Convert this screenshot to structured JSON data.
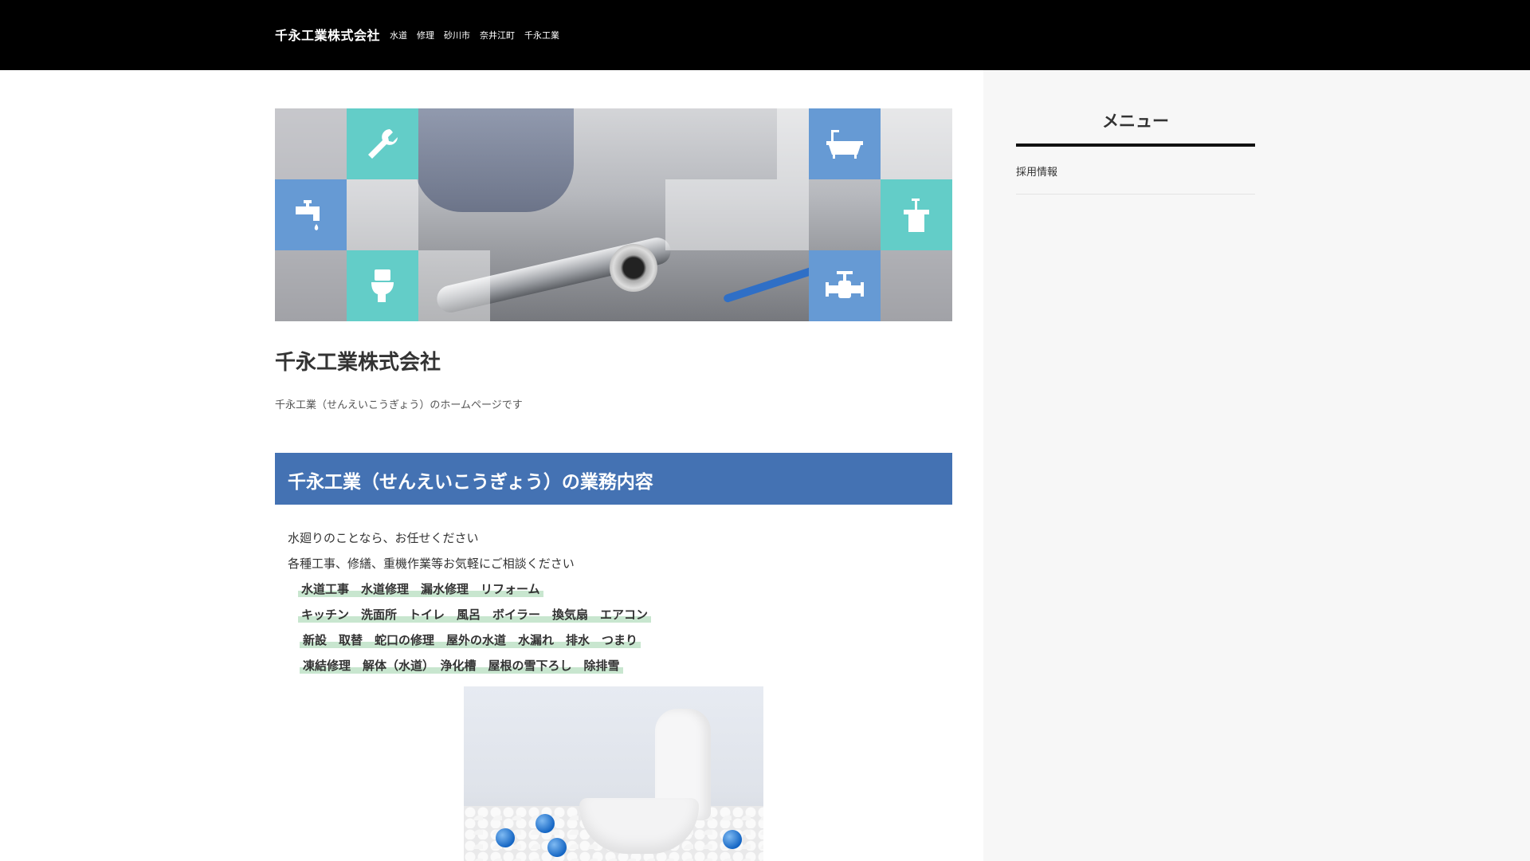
{
  "header": {
    "site_name": "千永工業株式会社",
    "tags": [
      "水道",
      "修理",
      "砂川市",
      "奈井江町",
      "千永工業"
    ]
  },
  "sidebar": {
    "menu_title": "メニュー",
    "items": [
      "採用情報"
    ]
  },
  "hero": {
    "tile_icons": [
      "wrench-icon",
      "bathtub-icon",
      "faucet-icon",
      "sink-icon",
      "toilet-icon",
      "valve-icon"
    ],
    "colors": {
      "teal": "#63cdc8",
      "blue": "#669ad4"
    }
  },
  "main": {
    "title": "千永工業株式会社",
    "subtitle": "千永工業（せんえいこうぎょう）のホームページです",
    "section_heading": "千永工業（せんえいこうぎょう）の業務内容",
    "intro": [
      "水廻りのことなら、お任せください",
      "各種工事、修繕、重機作業等お気軽にご相談ください"
    ],
    "highlights": [
      "水道工事　水道修理　漏水修理　リフォーム",
      "キッチン　洗面所　トイレ　風呂　ボイラー　換気扇　エアコン",
      "新設　取替　蛇口の修理　屋外の水道　水漏れ　排水　つまり",
      "凍結修理　解体（水道）　浄化槽　屋根の雪下ろし　除排雪"
    ]
  },
  "colors": {
    "header_bg": "#000000",
    "section_bg": "#4472b3",
    "highlight": "#c8e6cf",
    "sidebar_bg": "#f7f7f7"
  }
}
